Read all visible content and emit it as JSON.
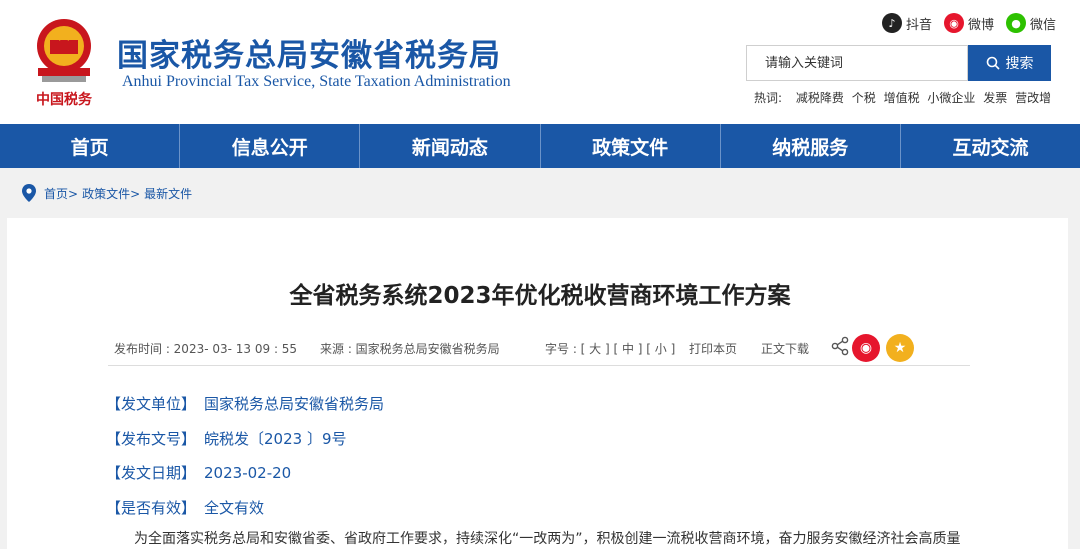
{
  "header": {
    "title_cn": "国家税务总局安徽省税务局",
    "title_en": "Anhui Provincial Tax Service, State Taxation Administration",
    "logo_caption": "中国税务"
  },
  "social": [
    {
      "label": "抖音",
      "icon": "douyin-icon",
      "color": "#222222"
    },
    {
      "label": "微博",
      "icon": "weibo-icon",
      "color": "#e6162d"
    },
    {
      "label": "微信",
      "icon": "wechat-icon",
      "color": "#2dc100"
    }
  ],
  "search": {
    "placeholder": "请输入关键词",
    "button_label": "搜索"
  },
  "hot": {
    "label": "热词:",
    "words": [
      "减税降费",
      "个税",
      "增值税",
      "小微企业",
      "发票",
      "营改增"
    ]
  },
  "nav": [
    "首页",
    "信息公开",
    "新闻动态",
    "政策文件",
    "纳税服务",
    "互动交流"
  ],
  "breadcrumb": [
    "首页>",
    "政策文件>",
    "最新文件"
  ],
  "article": {
    "title": "全省税务系统2023年优化税收营商环境工作方案",
    "publish_time": "发布时间 : 2023- 03- 13   09 : 55",
    "source": "来源 : 国家税务总局安徽省税务局",
    "font_size": "字号 : [ 大 ] [ 中 ] [ 小 ]",
    "print": "打印本页",
    "download": "正文下载",
    "fields": [
      {
        "label": "【发文单位】",
        "value": "国家税务总局安徽省税务局"
      },
      {
        "label": "【发布文号】",
        "value": "皖税发〔2023 〕9号"
      },
      {
        "label": "【发文日期】",
        "value": "2023-02-20"
      },
      {
        "label": "【是否有效】",
        "value": "全文有效"
      }
    ],
    "body_first_line": "为全面落实税务总局和安徽省委、省政府工作要求，持续深化“一改两为”，积极创建一流税收营商环境，奋力服务安徽经济社会高质量"
  },
  "colors": {
    "brand_blue": "#1a57a6",
    "weibo_red": "#e6162d",
    "favorite_gold": "#f2b01e"
  }
}
